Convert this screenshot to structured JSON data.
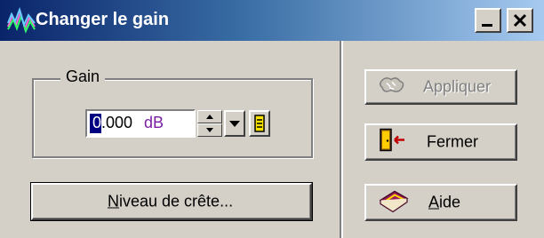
{
  "window": {
    "title": "Changer le gain"
  },
  "titlebar": {
    "minimize_icon": "minimize-icon",
    "close_icon": "close-icon"
  },
  "gain_group": {
    "label": "Gain",
    "value_first_char": "0",
    "value_rest": ".000",
    "unit": "dB"
  },
  "buttons": {
    "peak_level": {
      "prefix": "",
      "accel": "N",
      "rest": "iveau de crête..."
    },
    "apply": {
      "label": "Appliquer",
      "icon": "apply-icon",
      "enabled": false
    },
    "close": {
      "label": "Fermer",
      "icon": "exit-door-icon"
    },
    "help": {
      "accel": "A",
      "rest": "ide",
      "icon": "help-book-icon"
    }
  },
  "colors": {
    "title_gradient_start": "#0a246a",
    "title_gradient_end": "#a6caf0",
    "face": "#d4d0c8",
    "unit_color": "#7a1fa2"
  }
}
